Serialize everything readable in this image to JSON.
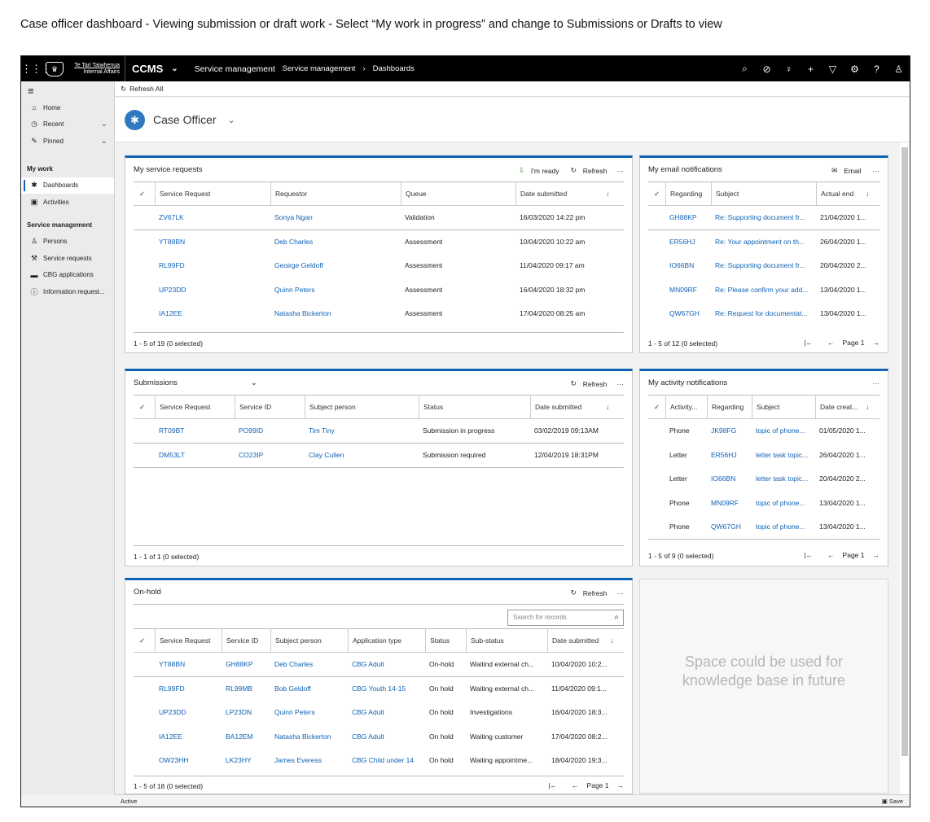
{
  "caption": "Case officer dashboard - Viewing submission or draft work - Select “My work in progress” and change to Submissions or Drafts to view",
  "topbar": {
    "org_line1": "Te Tari Taiwhenua",
    "org_line2": "Internal Affairs",
    "app": "CCMS",
    "area": "Service management",
    "crumb1": "Service management",
    "crumb2": "Dashboards"
  },
  "sidebar": {
    "top": [
      {
        "label": "Home"
      },
      {
        "label": "Recent"
      },
      {
        "label": "Pinned"
      }
    ],
    "section1": "My work",
    "mywork": [
      {
        "label": "Dashboards"
      },
      {
        "label": "Activities"
      }
    ],
    "section2": "Service management",
    "svc": [
      {
        "label": "Persons"
      },
      {
        "label": "Service requests"
      },
      {
        "label": "CBG applications"
      },
      {
        "label": "Information request..."
      }
    ]
  },
  "cmdbar": {
    "refresh_all": "Refresh All"
  },
  "header": {
    "title": "Case Officer"
  },
  "service_requests": {
    "title": "My service requests",
    "ready": "I'm ready",
    "refresh": "Refresh",
    "cols": [
      "Service Request",
      "Requestor",
      "Queue",
      "Date submitted"
    ],
    "rows": [
      [
        "ZV67LK",
        "Sonya Ngan",
        "Validation",
        "16/03/2020 14:22 pm"
      ],
      [
        "YT88BN",
        "Deb Charles",
        "Assessment",
        "10/04/2020 10:22 am"
      ],
      [
        "RL99FD",
        "Geoirge Geldoff",
        "Assessment",
        "11/04/2020 09:17 am"
      ],
      [
        "UP23DD",
        "Quinn Peters",
        "Assessment",
        "16/04/2020 18:32 pm"
      ],
      [
        "IA12EE",
        "Natasha Bickerton",
        "Assessment",
        "17/04/2020 08:25 am"
      ]
    ],
    "footer": "1 - 5 of 19 (0 selected)"
  },
  "email": {
    "title": "My email notifications",
    "email_btn": "Email",
    "cols": [
      "Regarding",
      "Subject",
      "Actual end"
    ],
    "rows": [
      [
        "GH88KP",
        "Re: Supporting document fr...",
        "21/04/2020 1..."
      ],
      [
        "ER56HJ",
        "Re: Your appointment on th...",
        "26/04/2020 1..."
      ],
      [
        "IO66BN",
        "Re: Supporting document fr...",
        "20/04/2020 2..."
      ],
      [
        "MN09RF",
        "Re: Please confirm your add...",
        "13/04/2020 1..."
      ],
      [
        "QW67GH",
        "Re: Request for documentat...",
        "13/04/2020 1..."
      ]
    ],
    "footer": "1 - 5 of 12 (0 selected)",
    "page": "Page 1"
  },
  "submissions": {
    "title": "Submissions",
    "refresh": "Refresh",
    "cols": [
      "Service Request",
      "Service ID",
      "Subject person",
      "Status",
      "Date submitted"
    ],
    "rows": [
      [
        "RT09BT",
        "PO99ID",
        "Tim Tiny",
        "Submission in progress",
        "03/02/2019 09:13AM"
      ],
      [
        "DM53LT",
        "CO23IP",
        "Clay Cullen",
        "Submission required",
        "12/04/2019 18:31PM"
      ]
    ],
    "footer": "1 - 1 of 1 (0 selected)"
  },
  "activity": {
    "title": "My activity notifications",
    "cols": [
      "Activity...",
      "Regarding",
      "Subject",
      "Date creat..."
    ],
    "rows": [
      [
        "Phone",
        "JK98FG",
        "topic of phone...",
        "01/05/2020 1..."
      ],
      [
        "Letter",
        "ER56HJ",
        "letter task topic...",
        "26/04/2020 1..."
      ],
      [
        "Letter",
        "IO66BN",
        "letter task topic...",
        "20/04/2020 2..."
      ],
      [
        "Phone",
        "MN09RF",
        "topic of phone...",
        "13/04/2020 1..."
      ],
      [
        "Phone",
        "QW67GH",
        "topic of phone...",
        "13/04/2020 1..."
      ]
    ],
    "footer": "1 - 5 of 9 (0 selected)",
    "page": "Page 1"
  },
  "onhold": {
    "title": "On-hold",
    "refresh": "Refresh",
    "search_placeholder": "Search for records",
    "cols": [
      "Service Request",
      "Service ID",
      "Subject person",
      "Application type",
      "Status",
      "Sub-status",
      "Date submitted"
    ],
    "rows": [
      [
        "YT88BN",
        "GH88KP",
        "Deb Charles",
        "CBG Adult",
        "On-hold",
        "Waitind external ch...",
        "10/04/2020 10:2..."
      ],
      [
        "RL99FD",
        "RL99MB",
        "Bob Geldoff",
        "CBG Youth 14-15",
        "On hold",
        "Waiting external ch...",
        "11/04/2020 09:1..."
      ],
      [
        "UP23DD",
        "LP23DN",
        "Quinn Peters",
        "CBG Adult",
        "On hold",
        "Investigations",
        "16/04/2020 18:3..."
      ],
      [
        "IA12EE",
        "BA12EM",
        "Natasha Bickerton",
        "CBG Adult",
        "On hold",
        "Waiting customer",
        "17/04/2020 08:2..."
      ],
      [
        "OW23HH",
        "LK23HY",
        "James Everess",
        "CBG Child under 14",
        "On hold",
        "Waiting appointme...",
        "18/04/2020 19:3..."
      ]
    ],
    "footer": "1 - 5 of 18 (0 selected)",
    "page": "Page 1"
  },
  "placeholder_text": "Space could be used for\nknowledge base in future",
  "status": {
    "state": "Active",
    "save": "Save"
  }
}
